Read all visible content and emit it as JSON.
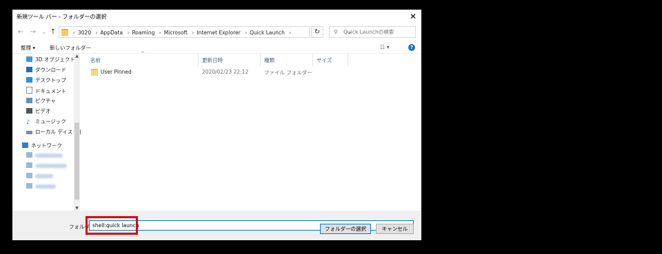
{
  "window": {
    "title": "新規ツール バー - フォルダーの選択",
    "close": "✕"
  },
  "nav": {
    "back": "←",
    "forward": "→",
    "history": "⌄",
    "up": "↑"
  },
  "breadcrumbs": [
    "3020",
    "AppData",
    "Roaming",
    "Microsoft",
    "Internet Explorer",
    "Quick Launch"
  ],
  "breadcrumb_separator": "›",
  "search": {
    "placeholder": "Quick Launchの検索"
  },
  "toolbar": {
    "organize": "整理 ▾",
    "new_folder": "新しいフォルダー",
    "help": "?"
  },
  "sidebar": {
    "items": [
      {
        "label": "3D オブジェクト",
        "icon": "3d-objects-icon",
        "color": "#3a9ad9"
      },
      {
        "label": "ダウンロード",
        "icon": "download-icon",
        "color": "#1f6fb8"
      },
      {
        "label": "デスクトップ",
        "icon": "desktop-icon",
        "color": "#2d8fd9"
      },
      {
        "label": "ドキュメント",
        "icon": "documents-icon",
        "color": "#8a8a8a"
      },
      {
        "label": "ピクチャ",
        "icon": "pictures-icon",
        "color": "#6a8fb5"
      },
      {
        "label": "ビデオ",
        "icon": "videos-icon",
        "color": "#555555"
      },
      {
        "label": "ミュージック",
        "icon": "music-icon",
        "color": "#2b7cd3"
      },
      {
        "label": "ローカル ディスク (C",
        "icon": "local-disk-icon",
        "color": "#6f8fa8"
      }
    ],
    "network": {
      "label": "ネットワーク",
      "icon": "network-icon",
      "color": "#2d7fd2"
    }
  },
  "columns": {
    "name": "名前",
    "date": "更新日時",
    "type": "種類",
    "size": "サイズ"
  },
  "files": [
    {
      "name": "User Pinned",
      "date": "2020/02/23 22:12",
      "type": "ファイル フォルダー",
      "size": ""
    }
  ],
  "footer": {
    "folder_label": "フォルダー:",
    "folder_value": "shell:quick launch",
    "select_button": "フォルダーの選択",
    "cancel_button": "キャンセル"
  },
  "colors": {
    "accent": "#0078d7",
    "highlight": "#e00000",
    "folder": "#f2cd5c"
  }
}
